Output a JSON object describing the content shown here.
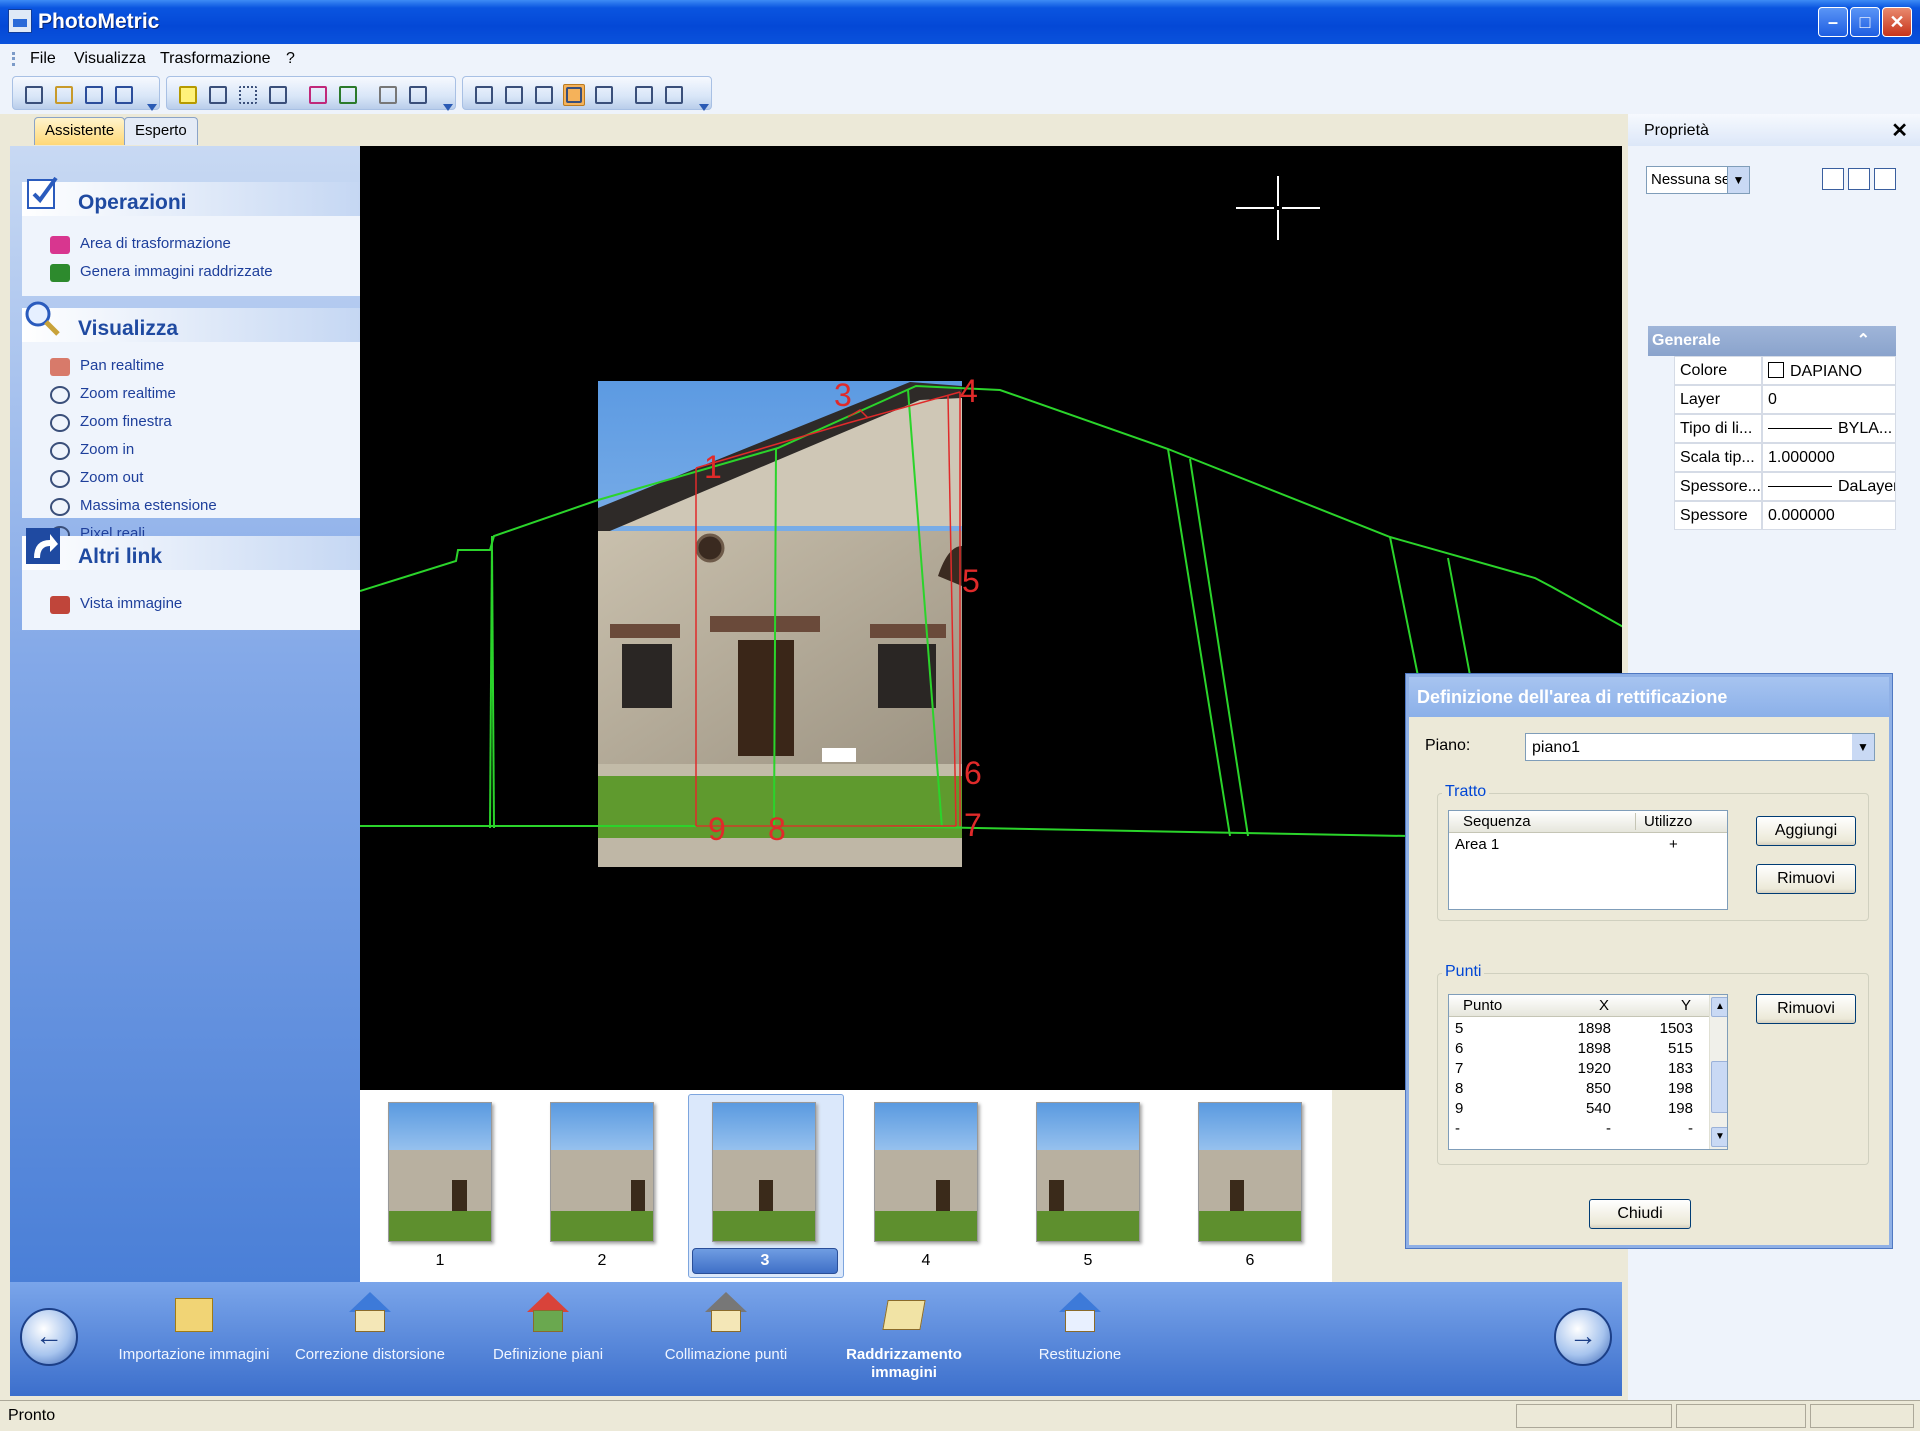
{
  "window": {
    "title": "PhotoMetric"
  },
  "menu": [
    "File",
    "Visualizza",
    "Trasformazione",
    "?"
  ],
  "tabs": [
    {
      "label": "Assistente",
      "active": true
    },
    {
      "label": "Esperto",
      "active": false
    }
  ],
  "left_panel": {
    "groups": [
      {
        "title": "Operazioni",
        "items": [
          "Area di trasformazione",
          "Genera immagini raddrizzate"
        ]
      },
      {
        "title": "Visualizza",
        "items": [
          "Pan realtime",
          "Zoom realtime",
          "Zoom finestra",
          "Zoom in",
          "Zoom out",
          "Massima estensione",
          "Pixel reali"
        ]
      },
      {
        "title": "Altri link",
        "items": [
          "Vista immagine"
        ]
      }
    ]
  },
  "viewport": {
    "point_labels": [
      "1",
      "3",
      "4",
      "5",
      "6",
      "7",
      "8",
      "9"
    ],
    "line_colors": {
      "outline": "#2bd42b",
      "rect": "#e02a2a"
    }
  },
  "thumbnails": {
    "labels": [
      "1",
      "2",
      "3",
      "4",
      "5",
      "6"
    ],
    "selected": "3"
  },
  "wizard": {
    "steps": [
      {
        "label": "Importazione immagini",
        "current": false
      },
      {
        "label": "Correzione distorsione",
        "current": false
      },
      {
        "label": "Definizione piani",
        "current": false
      },
      {
        "label": "Collimazione punti",
        "current": false
      },
      {
        "label": "Raddrizzamento immagini",
        "current": true
      },
      {
        "label": "Restituzione",
        "current": false
      }
    ],
    "prev": "←",
    "next": "→"
  },
  "statusbar": {
    "text": "Pronto"
  },
  "properties": {
    "title": "Proprietà",
    "close": "✕",
    "selector": "Nessuna se",
    "category": "Generale",
    "rows": [
      {
        "key": "Colore",
        "value": "DAPIANO"
      },
      {
        "key": "Layer",
        "value": "0"
      },
      {
        "key": "Tipo di li...",
        "value": "BYLA..."
      },
      {
        "key": "Scala tip...",
        "value": "1.000000"
      },
      {
        "key": "Spessore...",
        "value": "DaLayer"
      },
      {
        "key": "Spessore",
        "value": "0.000000"
      }
    ]
  },
  "dialog": {
    "title": "Definizione dell'area di rettificazione",
    "piano_label": "Piano:",
    "piano_value": "piano1",
    "tratto": {
      "legend": "Tratto",
      "headers": [
        "Sequenza",
        "Utilizzo"
      ],
      "rows": [
        {
          "sequenza": "Area 1",
          "utilizzo": "+"
        }
      ],
      "add_button": "Aggiungi",
      "remove_button": "Rimuovi"
    },
    "punti": {
      "legend": "Punti",
      "headers": [
        "Punto",
        "X",
        "Y"
      ],
      "rows": [
        {
          "punto": "5",
          "x": "1898",
          "y": "1503"
        },
        {
          "punto": "6",
          "x": "1898",
          "y": "515"
        },
        {
          "punto": "7",
          "x": "1920",
          "y": "183"
        },
        {
          "punto": "8",
          "x": "850",
          "y": "198"
        },
        {
          "punto": "9",
          "x": "540",
          "y": "198"
        },
        {
          "punto": "-",
          "x": "-",
          "y": "-"
        }
      ],
      "remove_button": "Rimuovi"
    },
    "close_button": "Chiudi"
  }
}
